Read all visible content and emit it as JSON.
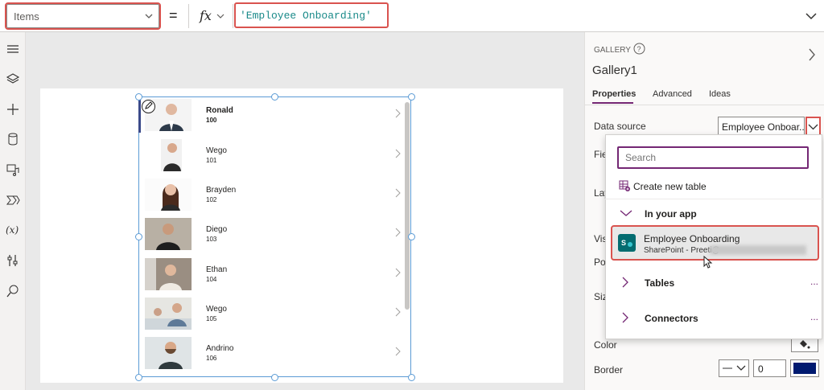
{
  "formula_bar": {
    "property": "Items",
    "equals": "=",
    "fx_label": "fx",
    "formula": "'Employee Onboarding'"
  },
  "gallery_items": [
    {
      "name": "Ronald",
      "id": "100"
    },
    {
      "name": "Wego",
      "id": "101"
    },
    {
      "name": "Brayden",
      "id": "102"
    },
    {
      "name": "Diego",
      "id": "103"
    },
    {
      "name": "Ethan",
      "id": "104"
    },
    {
      "name": "Wego",
      "id": "105"
    },
    {
      "name": "Andrino",
      "id": "106"
    }
  ],
  "panel": {
    "control_type": "GALLERY",
    "control_name": "Gallery1",
    "tabs": [
      "Properties",
      "Advanced",
      "Ideas"
    ],
    "data_source_label": "Data source",
    "data_source_value": "Employee Onboar...",
    "partial_labels": [
      "Fie",
      "Lay",
      "Vis",
      "Po",
      "Siz"
    ],
    "color_label": "Color",
    "border_label": "Border",
    "border_width": "0",
    "border_color": "#001a70"
  },
  "dropdown": {
    "search_placeholder": "Search",
    "create_new_table": "Create new table",
    "in_your_app": "In your app",
    "selected_source_title": "Employee Onboarding",
    "selected_source_sub": "SharePoint - Preeti@",
    "sp_badge": "S",
    "tables": "Tables",
    "connectors": "Connectors",
    "more": "..."
  },
  "colors": {
    "accent": "#742774",
    "highlight": "#d9534f",
    "formula_text": "#1a8a89",
    "selection": "#5b9bd5"
  }
}
